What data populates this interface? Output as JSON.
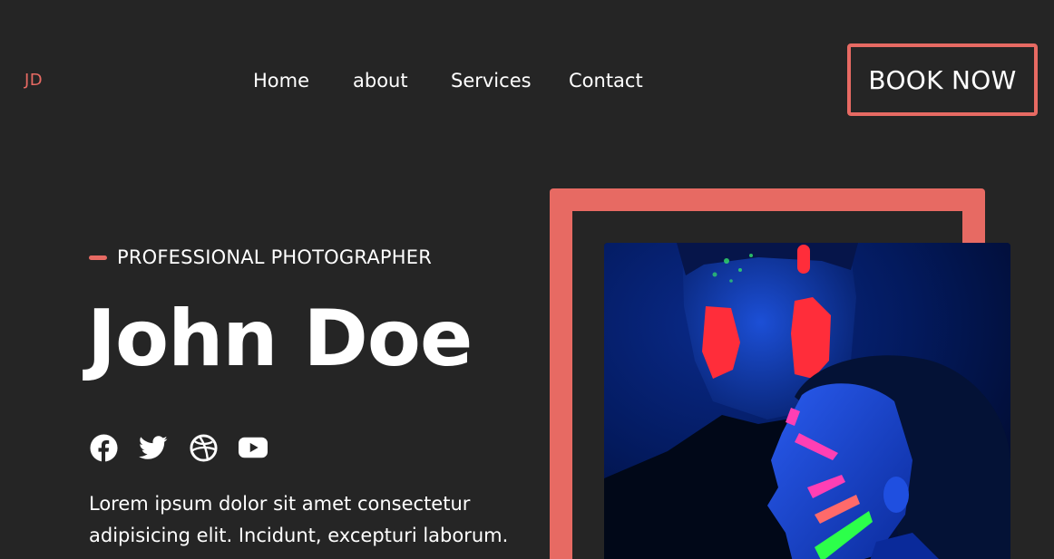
{
  "brand": {
    "logo_text": "JD",
    "accent_color": "#e76a63"
  },
  "nav": {
    "items": [
      {
        "label": "Home"
      },
      {
        "label": "about"
      },
      {
        "label": "Services"
      },
      {
        "label": "Contact"
      }
    ],
    "cta_label": "BOOK NOW"
  },
  "hero": {
    "eyebrow": "PROFESSIONAL PHOTOGRAPHER",
    "name": "John Doe",
    "description": "Lorem ipsum dolor sit amet consectetur adipisicing elit. Incidunt, excepturi laborum.",
    "socials": [
      {
        "icon": "facebook-icon"
      },
      {
        "icon": "twitter-icon"
      },
      {
        "icon": "dribbble-icon"
      },
      {
        "icon": "youtube-icon"
      }
    ],
    "image": {
      "subject": "neon-painted-faces-portrait"
    }
  },
  "colors": {
    "background": "#252525",
    "accent": "#e76a63",
    "text": "#ffffff"
  }
}
